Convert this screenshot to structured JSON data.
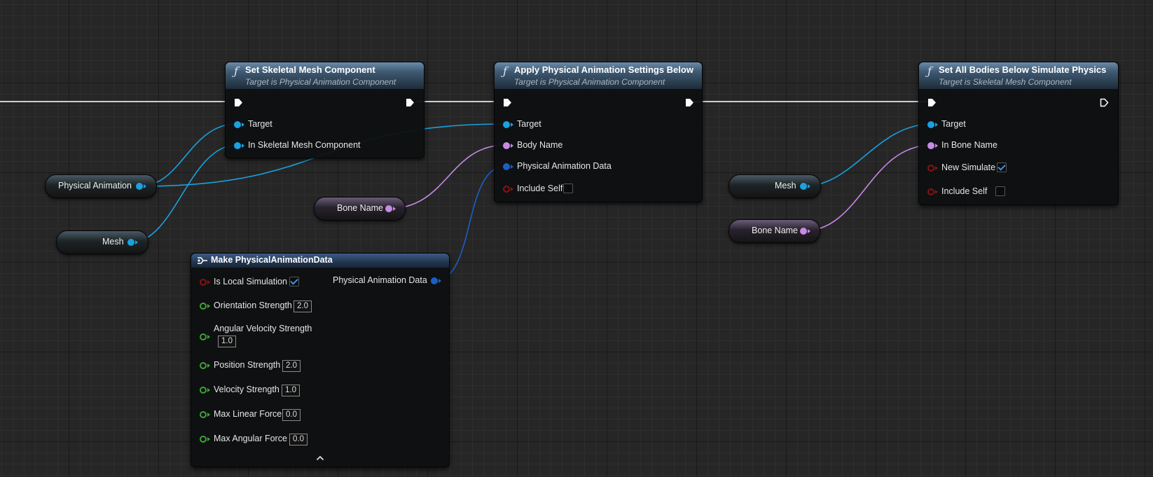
{
  "nodes": {
    "set_skeletal_mesh": {
      "title": "Set Skeletal Mesh Component",
      "subtitle": "Target is Physical Animation Component",
      "pins": {
        "target": "Target",
        "in_mesh": "In Skeletal Mesh Component"
      }
    },
    "apply_settings": {
      "title": "Apply Physical Animation Settings Below",
      "subtitle": "Target is Physical Animation Component",
      "pins": {
        "target": "Target",
        "body_name": "Body Name",
        "anim_data": "Physical Animation Data",
        "include_self": "Include Self"
      },
      "include_self_checked": false
    },
    "set_all_bodies": {
      "title": "Set All Bodies Below Simulate Physics",
      "subtitle": "Target is Skeletal Mesh Component",
      "pins": {
        "target": "Target",
        "in_bone_name": "In Bone Name",
        "new_simulate": "New Simulate",
        "include_self": "Include Self"
      },
      "new_simulate_checked": true,
      "include_self_checked": false
    },
    "make_data": {
      "title": "Make PhysicalAnimationData",
      "output": "Physical Animation Data",
      "fields": {
        "is_local_simulation": {
          "label": "Is Local Simulation",
          "checked": true
        },
        "orientation_strength": {
          "label": "Orientation Strength",
          "value": "2.0"
        },
        "angular_velocity_strength": {
          "label": "Angular Velocity Strength",
          "value": "1.0"
        },
        "position_strength": {
          "label": "Position Strength",
          "value": "2.0"
        },
        "velocity_strength": {
          "label": "Velocity Strength",
          "value": "1.0"
        },
        "max_linear_force": {
          "label": "Max Linear Force",
          "value": "0.0"
        },
        "max_angular_force": {
          "label": "Max Angular Force",
          "value": "0.0"
        }
      }
    }
  },
  "variables": {
    "physical_animation": "Physical Animation",
    "mesh_left": "Mesh",
    "bone_name_mid": "Bone Name",
    "mesh_right": "Mesh",
    "bone_name_right": "Bone Name"
  },
  "colors": {
    "object_pin": "#1aa1e0",
    "name_pin": "#c88ae6",
    "struct_pin": "#1b5fc4",
    "bool_pin": "#8f1010",
    "float_pin": "#3aa535",
    "exec_wire": "#d8d8d8"
  }
}
